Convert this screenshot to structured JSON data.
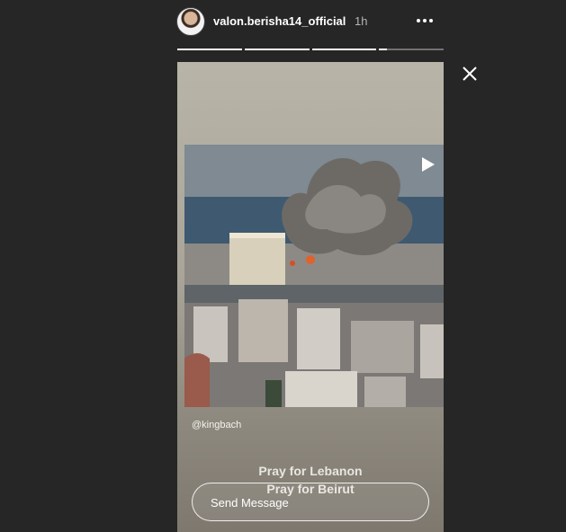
{
  "header": {
    "username": "valon.berisha14_official",
    "time": "1h",
    "more_icon": "more-horizontal-icon",
    "avatar_icon": "avatar"
  },
  "progress": {
    "bars": [
      1,
      1,
      1,
      0.12
    ]
  },
  "close_icon": "close-icon",
  "story": {
    "play_icon": "play-icon",
    "mention": "@kingbach",
    "caption_line1": "Pray for Lebanon",
    "caption_line2": "Pray for Beirut",
    "send_placeholder": "Send Message"
  },
  "colors": {
    "background": "#262626",
    "text": "#ffffff",
    "muted": "#b5b5b5"
  }
}
